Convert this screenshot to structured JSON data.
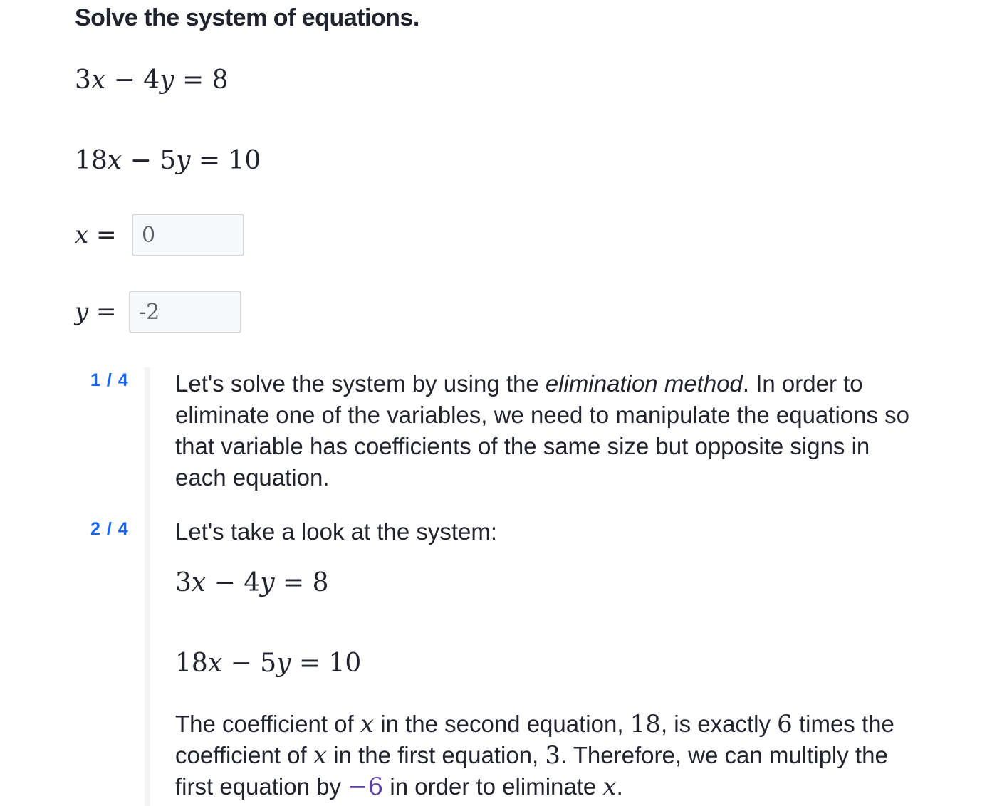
{
  "question": {
    "title": "Solve the system of equations.",
    "equation1": {
      "a": "3",
      "op": "−",
      "b": "4",
      "rhs": "8"
    },
    "equation2": {
      "a": "18",
      "op": "−",
      "b": "5",
      "rhs": "10"
    }
  },
  "answers": {
    "x_label": "x",
    "x_value": "0",
    "y_label": "y",
    "y_value": "-2"
  },
  "hints": {
    "step1": {
      "number": "1 / 4",
      "text_before": "Let's solve the system by using the ",
      "emphasis": "elimination method",
      "text_after": ". In order to eliminate one of the variables, we need to manipulate the equations so that variable has coefficients of the same size but opposite signs in each equation."
    },
    "step2": {
      "number": "2 / 4",
      "intro": "Let's take a look at the system:",
      "equation1": {
        "a": "3",
        "op": "−",
        "b": "4",
        "rhs": "8"
      },
      "equation2": {
        "a": "18",
        "op": "−",
        "b": "5",
        "rhs": "10"
      },
      "text_part1": "The coefficient of ",
      "var_x": "x",
      "text_part2": " in the second equation, ",
      "coef_second": "18",
      "text_part3": ", is exactly ",
      "factor": "6",
      "text_part4": " times the coefficient of ",
      "text_part5": " in the first equation, ",
      "coef_first": "3",
      "text_part6": ". Therefore, we can multiply the first equation by ",
      "multiplier": "−6",
      "text_part7": " in order to eliminate ",
      "text_part8": "."
    }
  },
  "colors": {
    "hint_number": "#1865f2",
    "multiplier": "#5b3ea8",
    "text": "#21242c"
  }
}
